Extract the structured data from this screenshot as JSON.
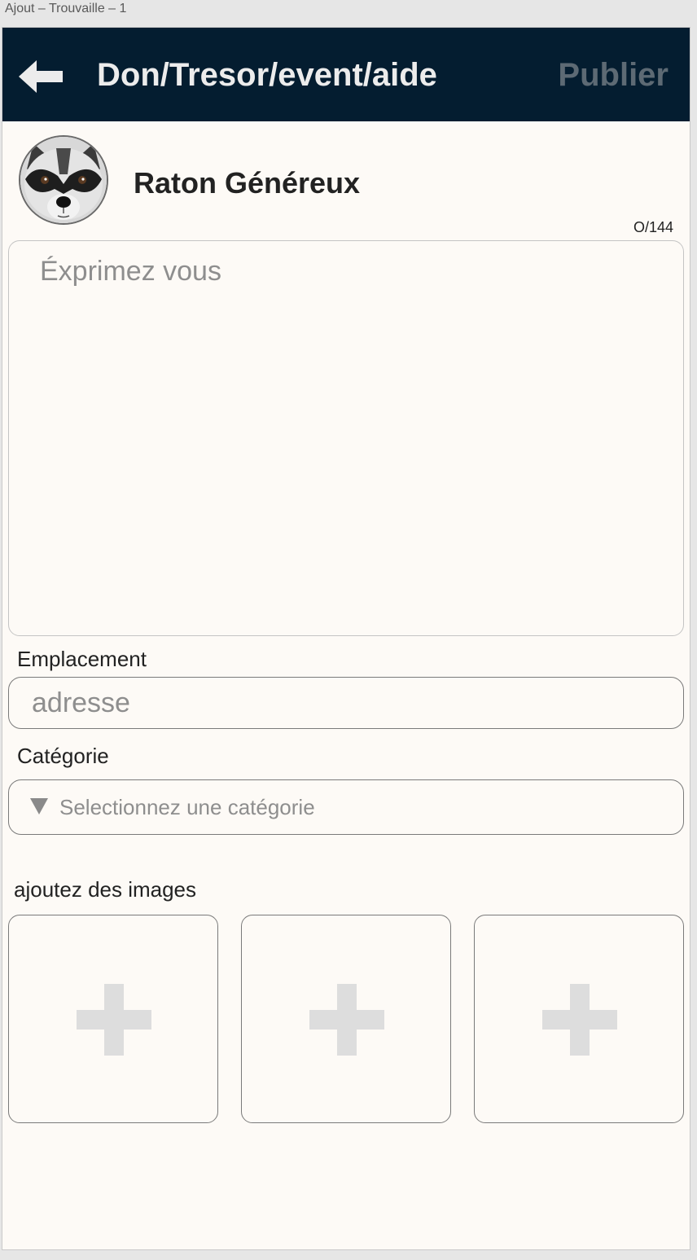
{
  "window": {
    "title": "Ajout – Trouvaille – 1"
  },
  "header": {
    "title": "Don/Tresor/event/aide",
    "publish_label": "Publier",
    "back_icon": "arrow-left-icon",
    "background_color": "#041d30"
  },
  "user": {
    "name": "Raton Généreux",
    "avatar": "raccoon-avatar"
  },
  "post": {
    "char_counter": "O/144",
    "placeholder": "Éxprimez vous",
    "value": ""
  },
  "location": {
    "label": "Emplacement",
    "placeholder": "adresse",
    "value": ""
  },
  "category": {
    "label": "Catégorie",
    "placeholder": "Selectionnez une catégorie",
    "icon": "triangle-down-icon"
  },
  "images": {
    "label": "ajoutez des images",
    "slots": [
      {
        "icon": "plus-icon"
      },
      {
        "icon": "plus-icon"
      },
      {
        "icon": "plus-icon"
      }
    ]
  }
}
